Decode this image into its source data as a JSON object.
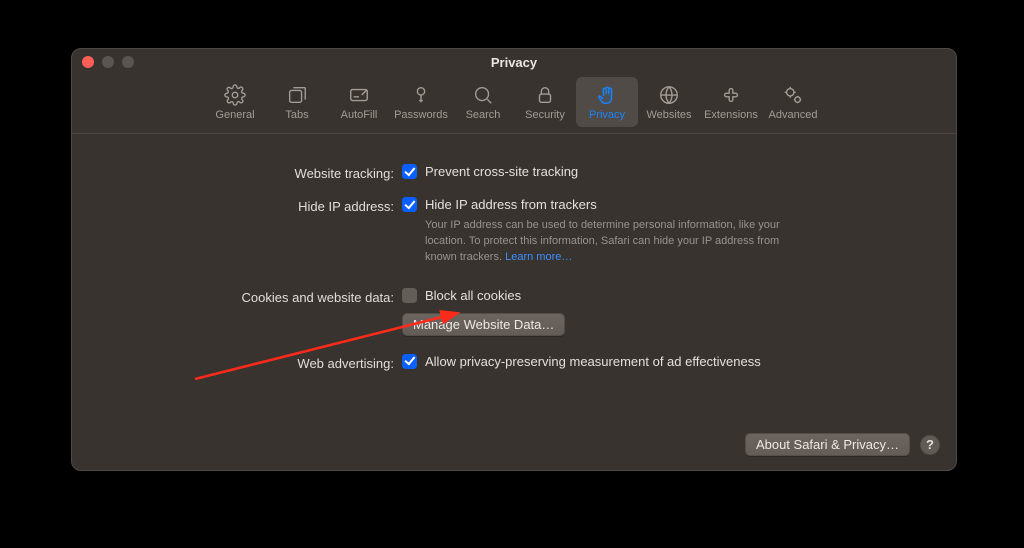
{
  "window": {
    "title": "Privacy"
  },
  "toolbar": {
    "items": [
      {
        "label": "General"
      },
      {
        "label": "Tabs"
      },
      {
        "label": "AutoFill"
      },
      {
        "label": "Passwords"
      },
      {
        "label": "Search"
      },
      {
        "label": "Security"
      },
      {
        "label": "Privacy"
      },
      {
        "label": "Websites"
      },
      {
        "label": "Extensions"
      },
      {
        "label": "Advanced"
      }
    ]
  },
  "sections": {
    "website_tracking": {
      "label": "Website tracking:",
      "checkbox": "Prevent cross-site tracking"
    },
    "hide_ip": {
      "label": "Hide IP address:",
      "checkbox": "Hide IP address from trackers",
      "desc": "Your IP address can be used to determine personal information, like your location. To protect this information, Safari can hide your IP address from known trackers. ",
      "learn_more": "Learn more…"
    },
    "cookies": {
      "label": "Cookies and website data:",
      "checkbox": "Block all cookies",
      "button": "Manage Website Data…"
    },
    "web_advertising": {
      "label": "Web advertising:",
      "checkbox": "Allow privacy-preserving measurement of ad effectiveness"
    }
  },
  "footer": {
    "about": "About Safari & Privacy…",
    "help": "?"
  }
}
